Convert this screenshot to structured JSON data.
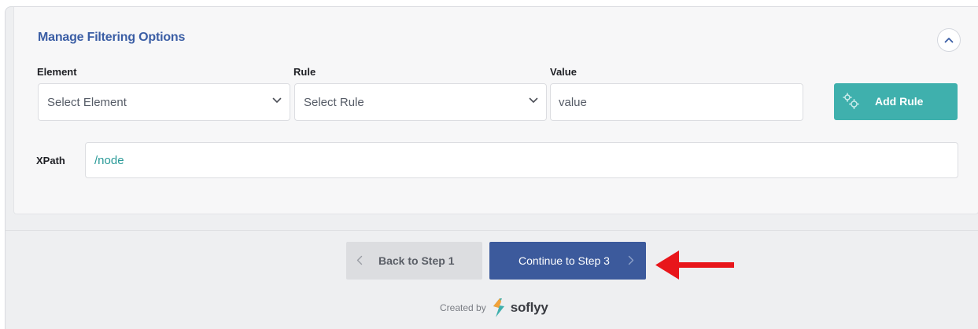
{
  "card": {
    "title": "Manage Filtering Options"
  },
  "fields": {
    "element": {
      "label": "Element",
      "placeholder": "Select Element"
    },
    "rule": {
      "label": "Rule",
      "placeholder": "Select Rule"
    },
    "value": {
      "label": "Value",
      "placeholder": "value"
    },
    "add_rule_label": "Add Rule"
  },
  "xpath": {
    "label": "XPath",
    "value": "/node"
  },
  "nav": {
    "back_label": "Back to Step 1",
    "continue_label": "Continue to Step 3"
  },
  "footer": {
    "created_by": "Created by",
    "brand": "soflyy"
  },
  "colors": {
    "title": "#3b5ea5",
    "add_rule_bg": "#3fb0ad",
    "continue_bg": "#3c5a9c",
    "back_bg": "#dcdde0",
    "xpath_text": "#2a9a98",
    "annotation_arrow": "#e8161b"
  },
  "icons": {
    "collapse": "chevron-up-icon",
    "select_caret": "chevron-down-icon",
    "add_rule": "gears-icon",
    "back": "chevron-left-icon",
    "continue": "chevron-right-icon",
    "annotation": "left-arrow-icon",
    "logo": "soflyy-logo-icon"
  }
}
